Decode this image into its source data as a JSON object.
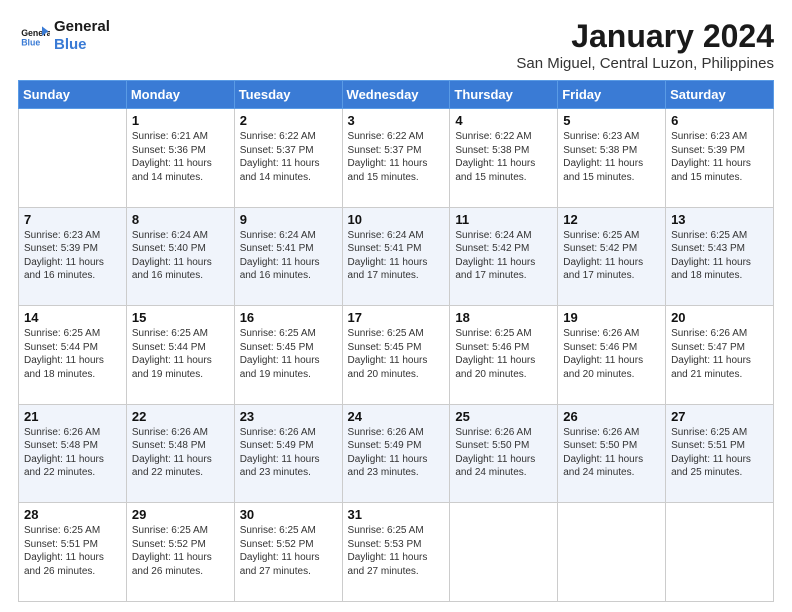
{
  "header": {
    "logo_line1": "General",
    "logo_line2": "Blue",
    "month_title": "January 2024",
    "location": "San Miguel, Central Luzon, Philippines"
  },
  "weekdays": [
    "Sunday",
    "Monday",
    "Tuesday",
    "Wednesday",
    "Thursday",
    "Friday",
    "Saturday"
  ],
  "rows": [
    [
      {
        "day": "",
        "info": ""
      },
      {
        "day": "1",
        "info": "Sunrise: 6:21 AM\nSunset: 5:36 PM\nDaylight: 11 hours\nand 14 minutes."
      },
      {
        "day": "2",
        "info": "Sunrise: 6:22 AM\nSunset: 5:37 PM\nDaylight: 11 hours\nand 14 minutes."
      },
      {
        "day": "3",
        "info": "Sunrise: 6:22 AM\nSunset: 5:37 PM\nDaylight: 11 hours\nand 15 minutes."
      },
      {
        "day": "4",
        "info": "Sunrise: 6:22 AM\nSunset: 5:38 PM\nDaylight: 11 hours\nand 15 minutes."
      },
      {
        "day": "5",
        "info": "Sunrise: 6:23 AM\nSunset: 5:38 PM\nDaylight: 11 hours\nand 15 minutes."
      },
      {
        "day": "6",
        "info": "Sunrise: 6:23 AM\nSunset: 5:39 PM\nDaylight: 11 hours\nand 15 minutes."
      }
    ],
    [
      {
        "day": "7",
        "info": "Sunrise: 6:23 AM\nSunset: 5:39 PM\nDaylight: 11 hours\nand 16 minutes."
      },
      {
        "day": "8",
        "info": "Sunrise: 6:24 AM\nSunset: 5:40 PM\nDaylight: 11 hours\nand 16 minutes."
      },
      {
        "day": "9",
        "info": "Sunrise: 6:24 AM\nSunset: 5:41 PM\nDaylight: 11 hours\nand 16 minutes."
      },
      {
        "day": "10",
        "info": "Sunrise: 6:24 AM\nSunset: 5:41 PM\nDaylight: 11 hours\nand 17 minutes."
      },
      {
        "day": "11",
        "info": "Sunrise: 6:24 AM\nSunset: 5:42 PM\nDaylight: 11 hours\nand 17 minutes."
      },
      {
        "day": "12",
        "info": "Sunrise: 6:25 AM\nSunset: 5:42 PM\nDaylight: 11 hours\nand 17 minutes."
      },
      {
        "day": "13",
        "info": "Sunrise: 6:25 AM\nSunset: 5:43 PM\nDaylight: 11 hours\nand 18 minutes."
      }
    ],
    [
      {
        "day": "14",
        "info": "Sunrise: 6:25 AM\nSunset: 5:44 PM\nDaylight: 11 hours\nand 18 minutes."
      },
      {
        "day": "15",
        "info": "Sunrise: 6:25 AM\nSunset: 5:44 PM\nDaylight: 11 hours\nand 19 minutes."
      },
      {
        "day": "16",
        "info": "Sunrise: 6:25 AM\nSunset: 5:45 PM\nDaylight: 11 hours\nand 19 minutes."
      },
      {
        "day": "17",
        "info": "Sunrise: 6:25 AM\nSunset: 5:45 PM\nDaylight: 11 hours\nand 20 minutes."
      },
      {
        "day": "18",
        "info": "Sunrise: 6:25 AM\nSunset: 5:46 PM\nDaylight: 11 hours\nand 20 minutes."
      },
      {
        "day": "19",
        "info": "Sunrise: 6:26 AM\nSunset: 5:46 PM\nDaylight: 11 hours\nand 20 minutes."
      },
      {
        "day": "20",
        "info": "Sunrise: 6:26 AM\nSunset: 5:47 PM\nDaylight: 11 hours\nand 21 minutes."
      }
    ],
    [
      {
        "day": "21",
        "info": "Sunrise: 6:26 AM\nSunset: 5:48 PM\nDaylight: 11 hours\nand 22 minutes."
      },
      {
        "day": "22",
        "info": "Sunrise: 6:26 AM\nSunset: 5:48 PM\nDaylight: 11 hours\nand 22 minutes."
      },
      {
        "day": "23",
        "info": "Sunrise: 6:26 AM\nSunset: 5:49 PM\nDaylight: 11 hours\nand 23 minutes."
      },
      {
        "day": "24",
        "info": "Sunrise: 6:26 AM\nSunset: 5:49 PM\nDaylight: 11 hours\nand 23 minutes."
      },
      {
        "day": "25",
        "info": "Sunrise: 6:26 AM\nSunset: 5:50 PM\nDaylight: 11 hours\nand 24 minutes."
      },
      {
        "day": "26",
        "info": "Sunrise: 6:26 AM\nSunset: 5:50 PM\nDaylight: 11 hours\nand 24 minutes."
      },
      {
        "day": "27",
        "info": "Sunrise: 6:25 AM\nSunset: 5:51 PM\nDaylight: 11 hours\nand 25 minutes."
      }
    ],
    [
      {
        "day": "28",
        "info": "Sunrise: 6:25 AM\nSunset: 5:51 PM\nDaylight: 11 hours\nand 26 minutes."
      },
      {
        "day": "29",
        "info": "Sunrise: 6:25 AM\nSunset: 5:52 PM\nDaylight: 11 hours\nand 26 minutes."
      },
      {
        "day": "30",
        "info": "Sunrise: 6:25 AM\nSunset: 5:52 PM\nDaylight: 11 hours\nand 27 minutes."
      },
      {
        "day": "31",
        "info": "Sunrise: 6:25 AM\nSunset: 5:53 PM\nDaylight: 11 hours\nand 27 minutes."
      },
      {
        "day": "",
        "info": ""
      },
      {
        "day": "",
        "info": ""
      },
      {
        "day": "",
        "info": ""
      }
    ]
  ]
}
